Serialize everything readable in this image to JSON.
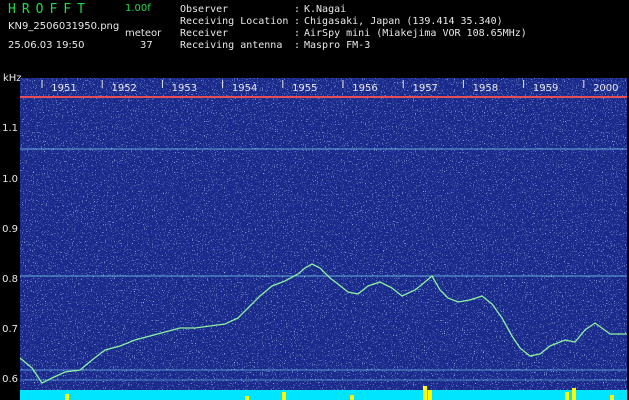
{
  "header": {
    "app_title": "HROFFT",
    "version": "1.00f",
    "filename": "KN9_2506031950.png",
    "mode": "meteor",
    "datetime": "25.06.03 19:50",
    "count": "37"
  },
  "info": [
    {
      "key": "Observer",
      "value": "K.Nagai"
    },
    {
      "key": "Receiving Location",
      "value": "Chigasaki, Japan (139.414 35.340)"
    },
    {
      "key": "Receiver",
      "value": "AirSpy mini (Miakejima VOR 108.65MHz)"
    },
    {
      "key": "Receiving antenna",
      "value": "Maspro FM-3"
    }
  ],
  "axis": {
    "unit": "kHz",
    "y_ticks": [
      "1.1",
      "1.0",
      "0.9",
      "0.8",
      "0.7",
      "0.6"
    ],
    "time_ticks": [
      "1951",
      "1952",
      "1953",
      "1954",
      "1955",
      "1956",
      "1957",
      "1958",
      "1959",
      "2000"
    ]
  },
  "colors": {
    "background": "#000000",
    "waterfall": "#1a2a8c",
    "header_green": "#22d84a",
    "trace": "#8cf0a0",
    "carrier": "#ff5050",
    "power_bar": "#00e5ff",
    "power_peak": "#ffff00"
  }
}
